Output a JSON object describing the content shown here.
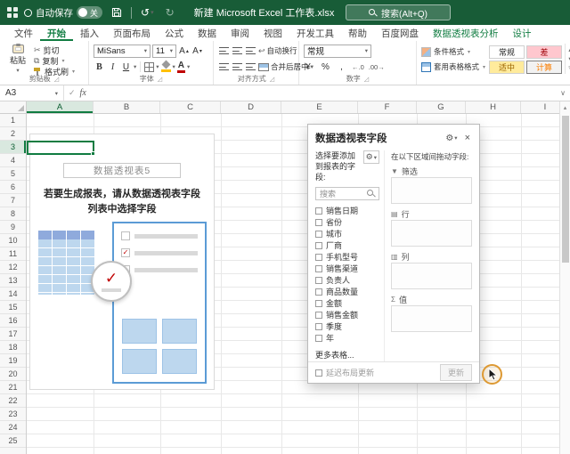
{
  "titlebar": {
    "autosave": "自动保存",
    "autosave_state": "关",
    "title": "新建 Microsoft Excel 工作表.xlsx",
    "search": "搜索(Alt+Q)"
  },
  "tabs": [
    "文件",
    "开始",
    "插入",
    "页面布局",
    "公式",
    "数据",
    "审阅",
    "视图",
    "开发工具",
    "帮助",
    "百度网盘",
    "数据透视表分析",
    "设计"
  ],
  "ribbon": {
    "clipboard": {
      "label": "剪贴板",
      "paste": "粘贴",
      "cut": "剪切",
      "copy": "复制",
      "format_painter": "格式刷"
    },
    "font": {
      "label": "字体",
      "name": "MiSans",
      "size": "11"
    },
    "alignment": {
      "label": "对齐方式",
      "wrap_text": "自动换行",
      "merge_center": "合并后居中"
    },
    "number": {
      "label": "数字",
      "format": "常规"
    },
    "styles": {
      "conditional": "条件格式",
      "format_table": "套用表格格式",
      "cell_styles": [
        "常规",
        "差",
        "适中",
        "计算"
      ]
    }
  },
  "formula_bar": {
    "name_box": "A3",
    "fx": "fx"
  },
  "grid": {
    "columns": [
      "A",
      "B",
      "C",
      "D",
      "E",
      "F",
      "G",
      "H",
      "I"
    ],
    "rows": [
      "1",
      "2",
      "3",
      "4",
      "5",
      "6",
      "7",
      "8",
      "9",
      "10",
      "11",
      "12",
      "13",
      "14",
      "15",
      "16",
      "17",
      "18",
      "19",
      "20",
      "21",
      "22",
      "23",
      "24",
      "25"
    ],
    "selected_cell": "A3"
  },
  "placeholder": {
    "title": "数据透视表5",
    "message": "若要生成报表，请从数据透视表字段列表中选择字段"
  },
  "fields_panel": {
    "title": "数据透视表字段",
    "choose": "选择要添加到报表的字段:",
    "search": "搜索",
    "fields": [
      "销售日期",
      "省份",
      "城市",
      "厂商",
      "手机型号",
      "销售渠道",
      "负责人",
      "商品数量",
      "金额",
      "销售金额",
      "季度",
      "年"
    ],
    "more": "更多表格...",
    "drag": "在以下区域间拖动字段:",
    "areas": [
      {
        "icon": "▼",
        "label": "筛选"
      },
      {
        "icon": "▤",
        "label": "行"
      },
      {
        "icon": "▥",
        "label": "列"
      },
      {
        "icon": "Σ",
        "label": "值"
      }
    ],
    "defer": "延迟布局更新",
    "update": "更新"
  },
  "icons": {
    "dropdown": "▾",
    "up": "▴",
    "chevron": "∨",
    "launcher": "◿",
    "undo": "↺",
    "redo": "↻",
    "check": "✓",
    "close": "×",
    "gear": "⚙",
    "cut": "✂",
    "copy": "⧉",
    "bold": "B",
    "italic": "I",
    "underline": "U",
    "fontA": "A",
    "currency": "¥",
    "percent": "%",
    "comma": ",",
    "inc_decimal": "←.0",
    "dec_decimal": ".00→",
    "more": "▿",
    "wrap": "↩",
    "orientation": "⇗"
  },
  "colors": {
    "accent_green": "#107C41",
    "titlebar_green": "#185C37",
    "click_ring": "#DD9933"
  }
}
